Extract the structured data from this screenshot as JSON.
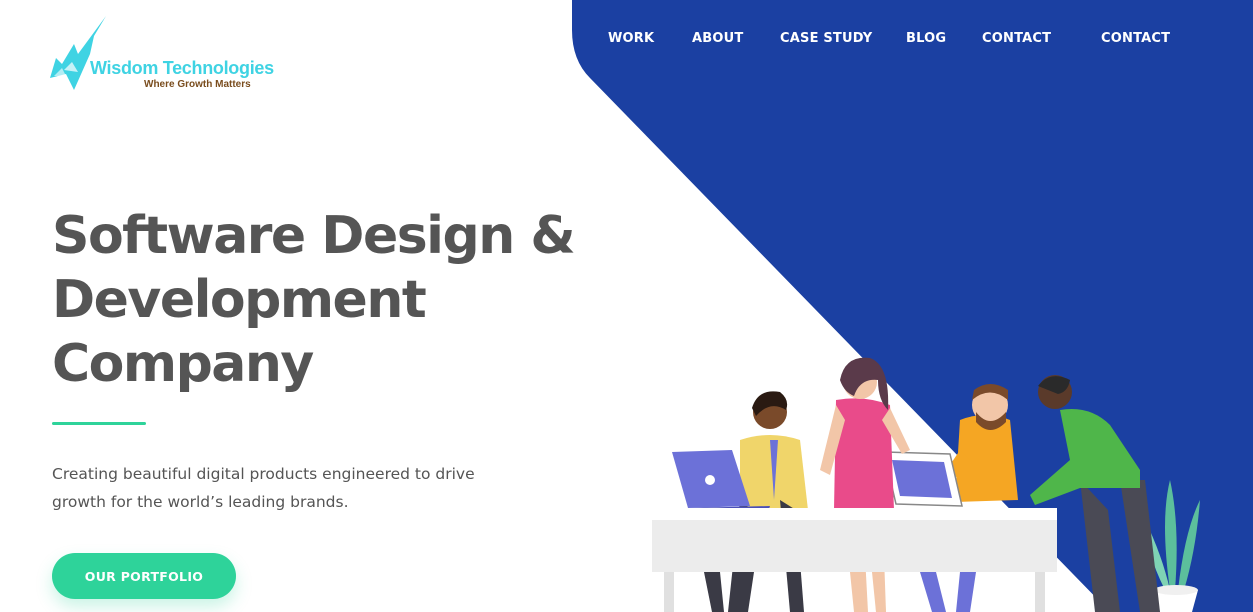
{
  "colors": {
    "brand_blue": "#1b40a2",
    "accent_green": "#2ed39a",
    "logo_cyan": "#3fd3e3",
    "heading_gray": "#555555"
  },
  "logo": {
    "name": "Wisdom Technologies",
    "tagline": "Where Growth Matters",
    "icon": "logo-icon"
  },
  "nav": {
    "items": [
      {
        "label": "WORK"
      },
      {
        "label": "ABOUT"
      },
      {
        "label": "CASE STUDY"
      },
      {
        "label": "BLOG"
      },
      {
        "label": "CONTACT"
      },
      {
        "label": "CONTACT"
      }
    ]
  },
  "hero": {
    "title_lines": [
      "Software Design &",
      "Development",
      "Company"
    ],
    "description": "Creating beautiful digital products engineered to drive growth for the world’s leading brands.",
    "cta_label": "OUR PORTFOLIO"
  },
  "illustration": {
    "icon": "team-at-desk-illustration"
  }
}
